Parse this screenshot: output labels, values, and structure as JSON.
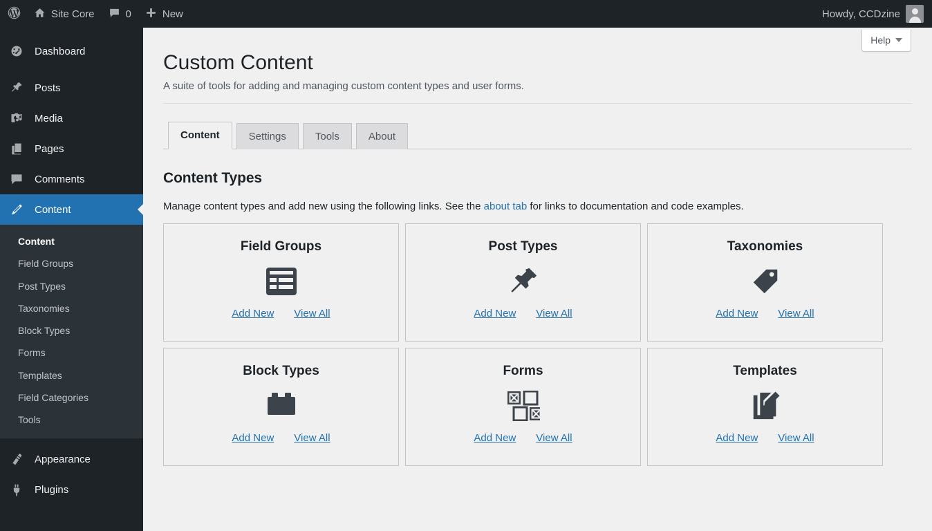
{
  "adminbar": {
    "logo_icon": "wordpress-logo-icon",
    "site": {
      "icon": "home-icon",
      "label": "Site Core"
    },
    "comments": {
      "icon": "comment-bubble-icon",
      "count": "0"
    },
    "new": {
      "icon": "plus-icon",
      "label": "New"
    },
    "account": {
      "greeting": "Howdy, CCDzine",
      "avatar_icon": "user-avatar-icon"
    }
  },
  "sidebar": {
    "items": [
      {
        "label": "Dashboard",
        "icon": "dashboard-gauge-icon",
        "current": false
      },
      {
        "label": "Posts",
        "icon": "pushpin-icon",
        "current": false
      },
      {
        "label": "Media",
        "icon": "media-camera-music-icon",
        "current": false
      },
      {
        "label": "Pages",
        "icon": "pages-stack-icon",
        "current": false
      },
      {
        "label": "Comments",
        "icon": "comment-bubble-icon",
        "current": false
      },
      {
        "label": "Content",
        "icon": "pencil-edit-icon",
        "current": true
      },
      {
        "label": "Appearance",
        "icon": "paintbrush-icon",
        "current": false
      },
      {
        "label": "Plugins",
        "icon": "plug-icon",
        "current": false
      }
    ],
    "submenu": [
      {
        "label": "Content",
        "current": true
      },
      {
        "label": "Field Groups",
        "current": false
      },
      {
        "label": "Post Types",
        "current": false
      },
      {
        "label": "Taxonomies",
        "current": false
      },
      {
        "label": "Block Types",
        "current": false
      },
      {
        "label": "Forms",
        "current": false
      },
      {
        "label": "Templates",
        "current": false
      },
      {
        "label": "Field Categories",
        "current": false
      },
      {
        "label": "Tools",
        "current": false
      }
    ]
  },
  "help": {
    "label": "Help",
    "icon": "chevron-down-icon"
  },
  "page": {
    "title": "Custom Content",
    "description": "A suite of tools for adding and managing custom content types and user forms."
  },
  "tabs": [
    {
      "label": "Content",
      "active": true
    },
    {
      "label": "Settings",
      "active": false
    },
    {
      "label": "Tools",
      "active": false
    },
    {
      "label": "About",
      "active": false
    }
  ],
  "section": {
    "title": "Content Types",
    "desc_before": "Manage content types and add new using the following links. See the ",
    "desc_link": "about tab",
    "desc_after": " for links to documentation and code examples."
  },
  "cards": [
    {
      "title": "Field Groups",
      "icon": "field-group-layout-icon",
      "add_new": "Add New",
      "view_all": "View All"
    },
    {
      "title": "Post Types",
      "icon": "pushpin-icon",
      "add_new": "Add New",
      "view_all": "View All"
    },
    {
      "title": "Taxonomies",
      "icon": "tag-icon",
      "add_new": "Add New",
      "view_all": "View All"
    },
    {
      "title": "Block Types",
      "icon": "lego-brick-icon",
      "add_new": "Add New",
      "view_all": "View All"
    },
    {
      "title": "Forms",
      "icon": "checkbox-grid-icon",
      "add_new": "Add New",
      "view_all": "View All"
    },
    {
      "title": "Templates",
      "icon": "page-edit-pencil-icon",
      "add_new": "Add New",
      "view_all": "View All"
    }
  ],
  "colors": {
    "adminbar_bg": "#1d2327",
    "sidebar_bg": "#1d2327",
    "submenu_bg": "#2c3338",
    "accent_blue": "#2271b1",
    "link_blue": "#2271b1",
    "content_bg": "#f0f0f1",
    "icon_dark": "#3c434a",
    "border_gray": "#c3c4c7"
  }
}
